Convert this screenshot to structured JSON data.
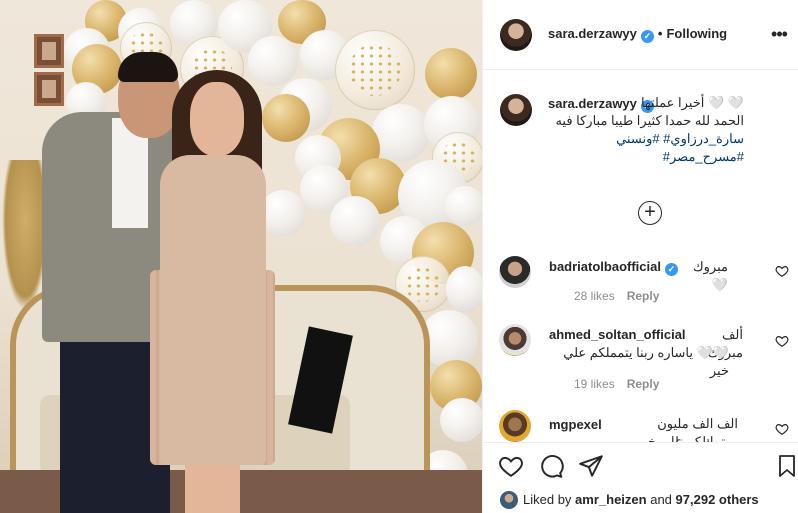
{
  "post": {
    "author": "sara.derzawyy",
    "follow_status": "Following",
    "separator": "•"
  },
  "caption": {
    "author": "sara.derzawyy",
    "line1": "🤍 🤍 أخيرا عملتها",
    "line2": "الحمد لله حمدا كثيرا طيبا مباركا فيه",
    "line3": "سارة_درزاوي# #ونسني #مسرح_مصر#"
  },
  "comments": [
    {
      "username": "badriatolbaofficial",
      "verified": true,
      "text": "مبروك🤍",
      "likes": "28 likes",
      "reply": "Reply"
    },
    {
      "username": "ahmed_soltan_official",
      "verified": false,
      "text_line1": "ألف مبروك",
      "text_line2": "🤍🤍 ياساره ربنا يتمملكم علي خير",
      "likes": "19 likes",
      "reply": "Reply"
    },
    {
      "username": "mgpexel",
      "verified": false,
      "text_line1": "الف الف مليون مبروك وربنا",
      "text_line2": "يتمملكم علي خير"
    }
  ],
  "likes": {
    "prefix": "Liked by",
    "user": "amr_heizen",
    "connector": "and",
    "others": "97,292 others"
  },
  "icons": {
    "more": "more-options-icon",
    "load_more": "plus-circle-icon",
    "like": "heart-icon",
    "comment": "comment-bubble-icon",
    "share": "paper-plane-icon",
    "save": "bookmark-icon",
    "verified": "verified-badge-icon"
  },
  "colors": {
    "verified_blue": "#3897f0",
    "hashtag": "#00376b",
    "muted": "#8e8e8e"
  }
}
